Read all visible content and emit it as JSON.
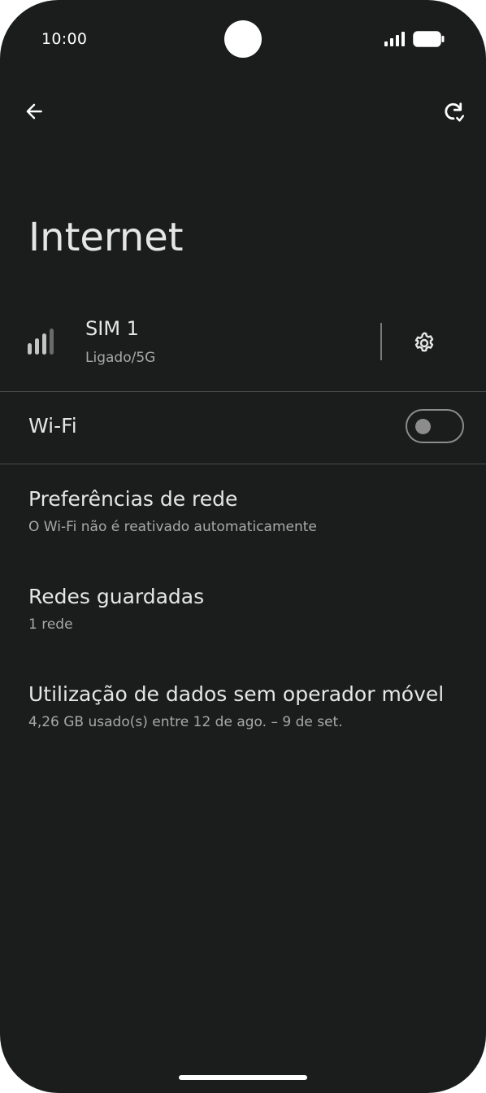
{
  "status_bar": {
    "time": "10:00",
    "signal_icon": "cell-signal-icon",
    "battery_icon": "battery-icon"
  },
  "toolbar": {
    "back_icon": "arrow-back-icon",
    "refresh_icon": "refresh-icon"
  },
  "page": {
    "title": "Internet"
  },
  "sim": {
    "title": "SIM 1",
    "subtitle": "Ligado/5G",
    "icon": "signal-bars-icon",
    "settings_icon": "gear-icon"
  },
  "wifi": {
    "label": "Wi-Fi",
    "enabled": false
  },
  "items": [
    {
      "title": "Preferências de rede",
      "subtitle": "O Wi-Fi não é reativado automaticamente"
    },
    {
      "title": "Redes guardadas",
      "subtitle": "1 rede"
    },
    {
      "title": "Utilização de dados sem operador móvel",
      "subtitle": "4,26 GB usado(s) entre 12 de ago. – 9 de set."
    }
  ],
  "colors": {
    "background": "#1b1c1c",
    "text_primary": "#e6e6e6",
    "text_secondary": "#a8a8a8",
    "divider": "#4a4a4a"
  }
}
